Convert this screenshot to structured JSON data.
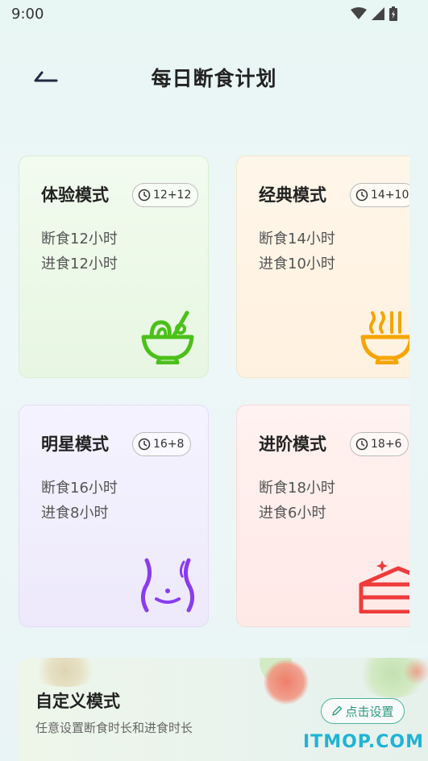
{
  "status_bar": {
    "time": "9:00",
    "icons": [
      "wifi-icon",
      "signal-icon",
      "battery-icon"
    ]
  },
  "header": {
    "title": "每日断食计划",
    "back_icon": "back-arrow-icon"
  },
  "plans": [
    {
      "name": "体验模式",
      "badge": "12+12",
      "fast": "断食12小时",
      "eat": "进食12小时",
      "icon": "salad-bowl-icon",
      "accent": "#4cc01a"
    },
    {
      "name": "经典模式",
      "badge": "14+10",
      "fast": "断食14小时",
      "eat": "进食10小时",
      "icon": "noodle-bowl-icon",
      "accent": "#f5a500"
    },
    {
      "name": "明星模式",
      "badge": "16+8",
      "fast": "断食16小时",
      "eat": "进食8小时",
      "icon": "waist-icon",
      "accent": "#8a3cf0"
    },
    {
      "name": "进阶模式",
      "badge": "18+6",
      "fast": "断食18小时",
      "eat": "进食6小时",
      "icon": "cake-icon",
      "accent": "#ee3b3b"
    }
  ],
  "custom": {
    "title": "自定义模式",
    "subtitle": "任意设置断食时长和进食时长",
    "button": "点击设置",
    "button_icon": "pencil-icon"
  },
  "watermark": "ITMOP.COM"
}
